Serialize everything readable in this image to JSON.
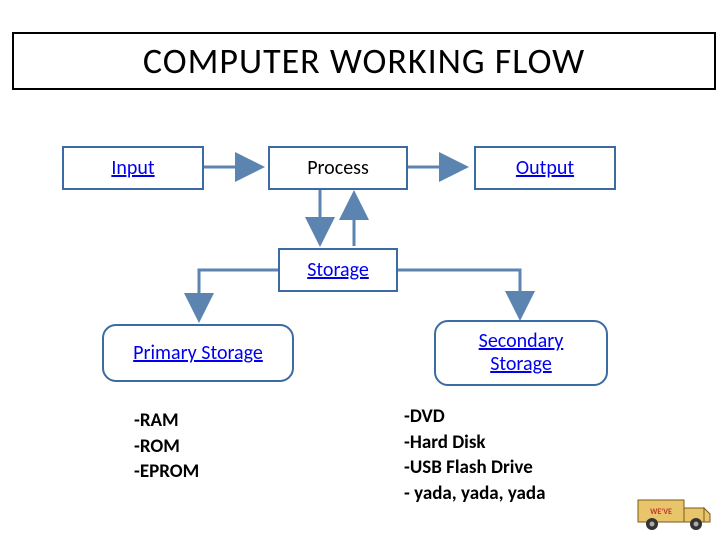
{
  "title": "COMPUTER WORKING FLOW",
  "nodes": {
    "input": "Input",
    "process": "Process",
    "output": "Output",
    "storage": "Storage",
    "primary": "Primary Storage",
    "secondary": "Secondary\nStorage"
  },
  "lists": {
    "primary": [
      "RAM",
      "ROM",
      "EPROM"
    ],
    "secondary": [
      "DVD",
      "Hard Disk",
      "USB Flash Drive",
      " yada, yada, yada"
    ]
  },
  "truck_label": "WE'VE MOVED"
}
